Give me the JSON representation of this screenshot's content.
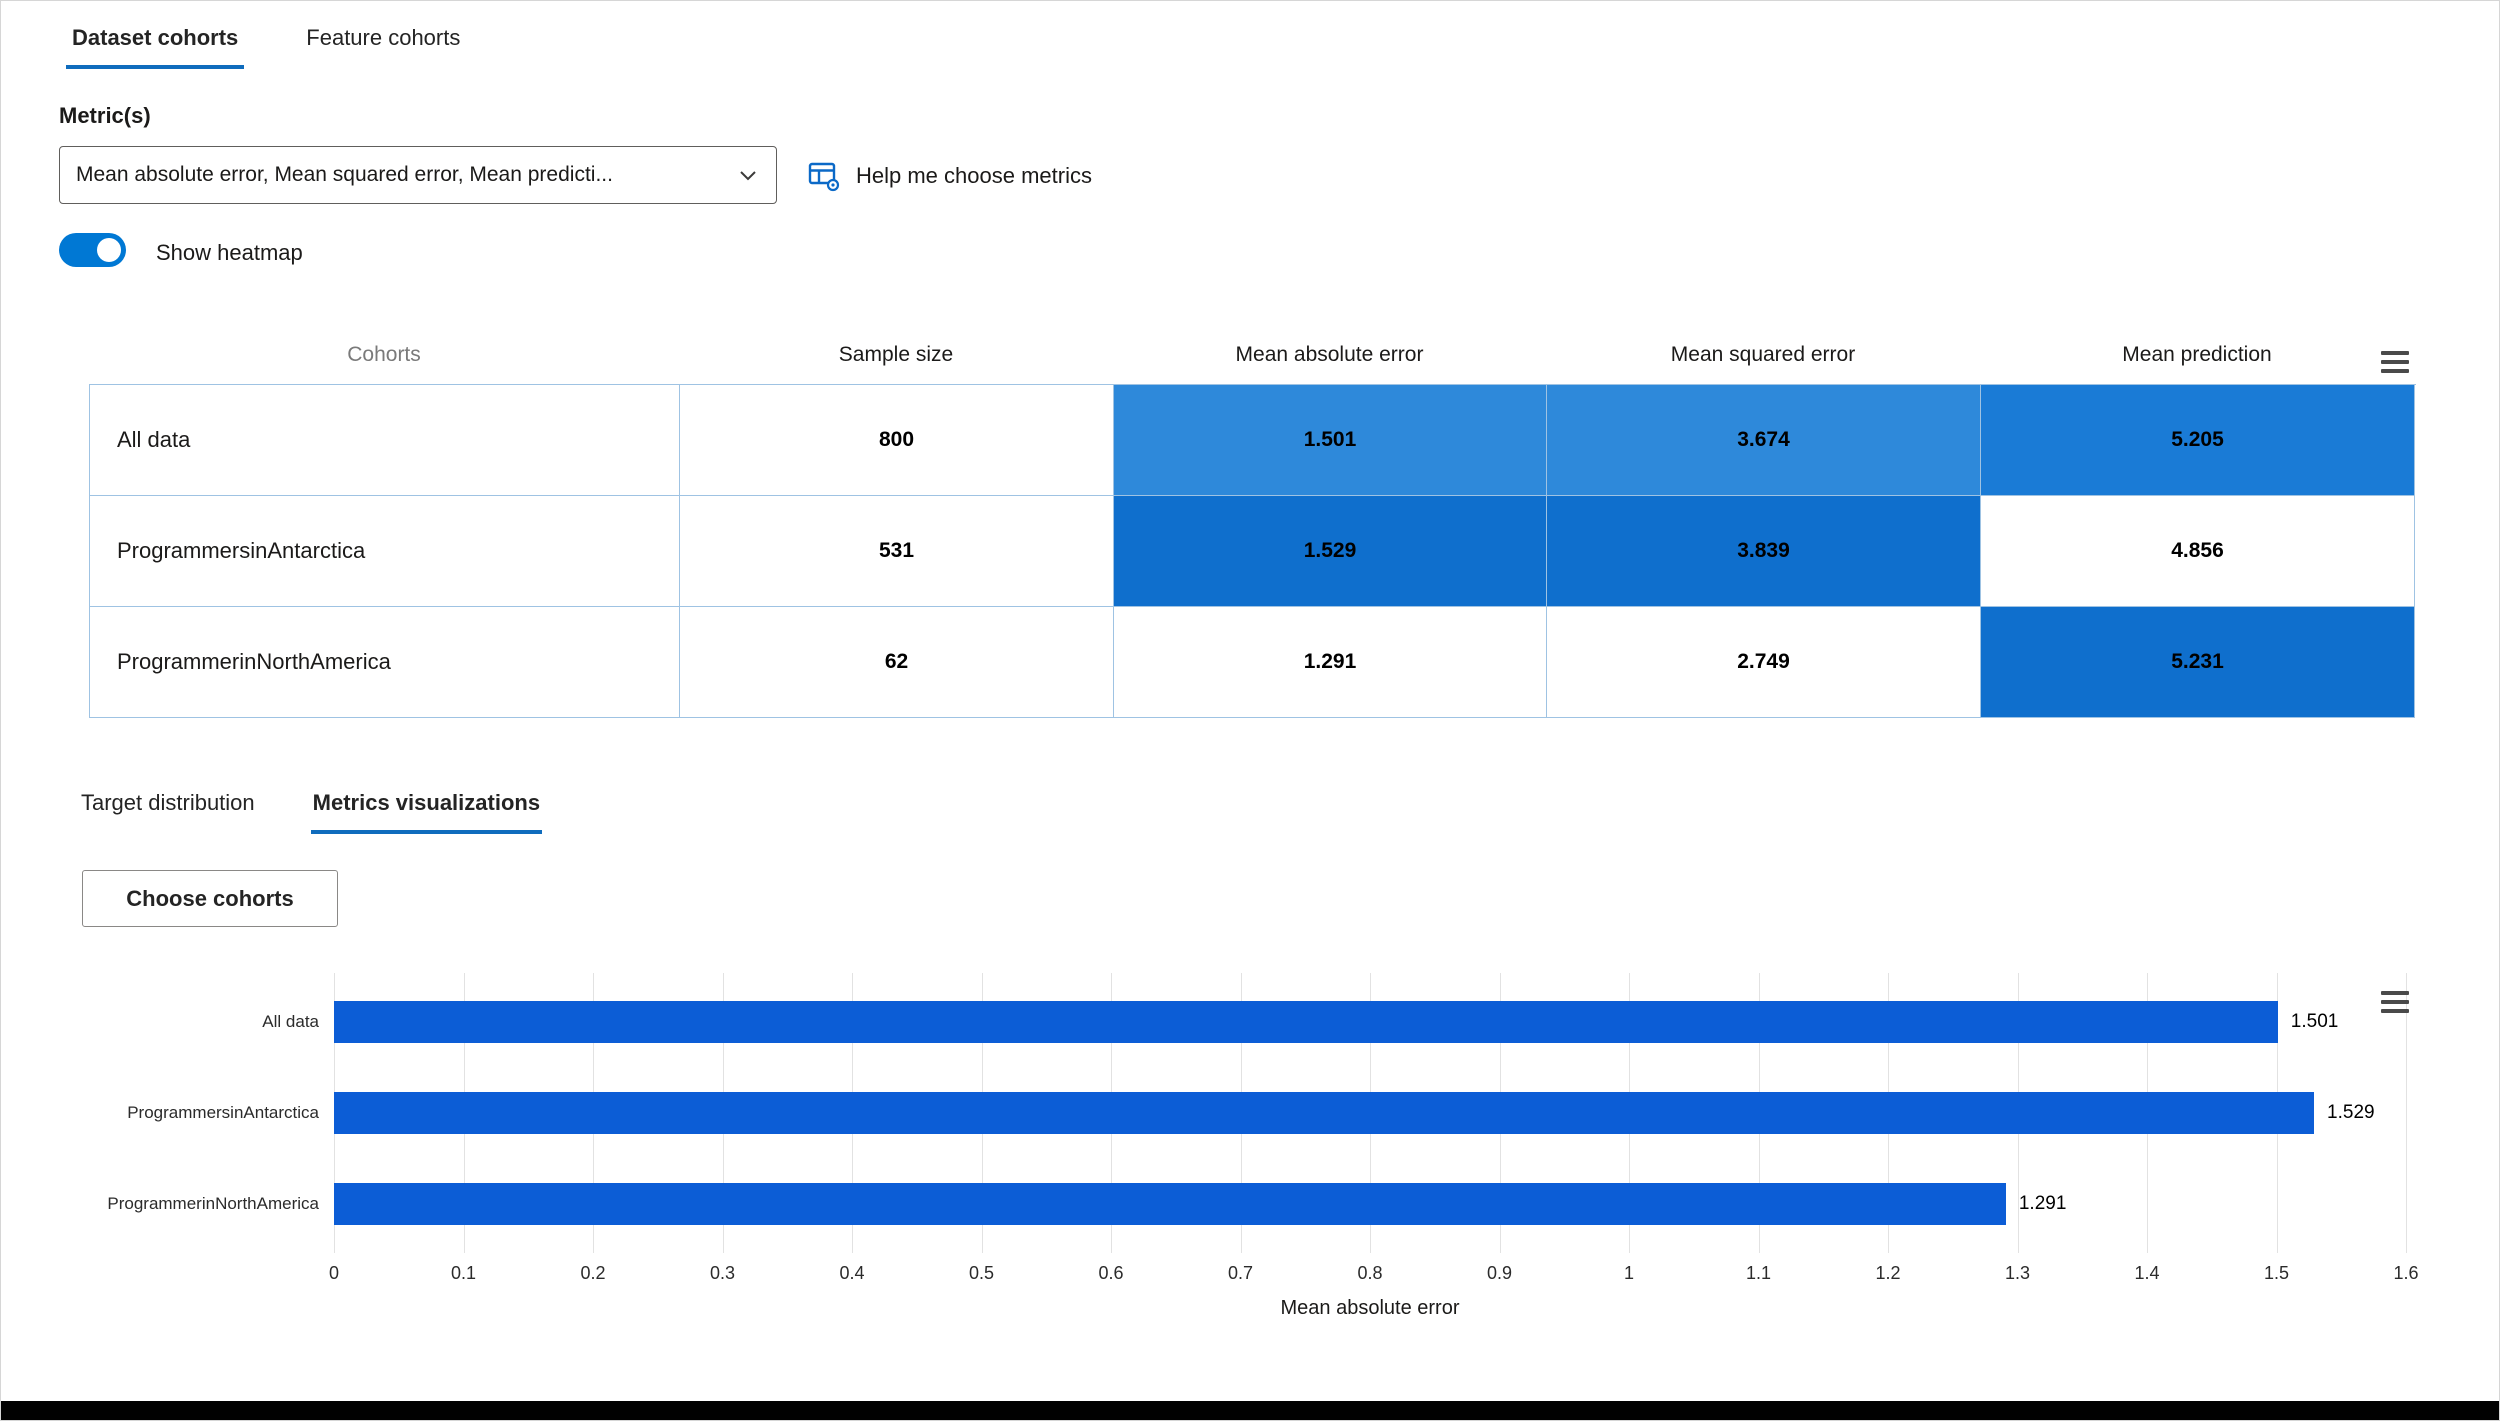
{
  "accent_color": "#0f6cbd",
  "tabs": {
    "dataset_cohorts": "Dataset cohorts",
    "feature_cohorts": "Feature cohorts"
  },
  "metrics_section": {
    "label": "Metric(s)",
    "dropdown_value": "Mean absolute error, Mean squared error, Mean predicti...",
    "help_label": "Help me choose metrics"
  },
  "heatmap_toggle": {
    "label": "Show heatmap",
    "state": "on"
  },
  "table": {
    "headers": [
      "Cohorts",
      "Sample size",
      "Mean absolute error",
      "Mean squared error",
      "Mean prediction"
    ],
    "rows": [
      {
        "cohort": "All data",
        "sample_size": "800",
        "metrics": [
          {
            "value": "1.501",
            "bg": "#2e89da"
          },
          {
            "value": "3.674",
            "bg": "#2e89da"
          },
          {
            "value": "5.205",
            "bg": "#1a7bd6"
          }
        ]
      },
      {
        "cohort": "ProgrammersinAntarctica",
        "sample_size": "531",
        "metrics": [
          {
            "value": "1.529",
            "bg": "#0f6fcd"
          },
          {
            "value": "3.839",
            "bg": "#0f6fcd"
          },
          {
            "value": "4.856",
            "bg": "#ffffff"
          }
        ]
      },
      {
        "cohort": "ProgrammerinNorthAmerica",
        "sample_size": "62",
        "metrics": [
          {
            "value": "1.291",
            "bg": "#ffffff"
          },
          {
            "value": "2.749",
            "bg": "#ffffff"
          },
          {
            "value": "5.231",
            "bg": "#0f6fcd"
          }
        ]
      }
    ]
  },
  "sub_tabs": {
    "target_distribution": "Target distribution",
    "metrics_visualizations": "Metrics visualizations"
  },
  "choose_cohorts_label": "Choose cohorts",
  "chart_data": {
    "type": "bar",
    "orientation": "horizontal",
    "title": "",
    "categories": [
      "All data",
      "ProgrammersinAntarctica",
      "ProgrammerinNorthAmerica"
    ],
    "values": [
      1.501,
      1.529,
      1.291
    ],
    "value_labels": [
      "1.501",
      "1.529",
      "1.291"
    ],
    "xlabel": "Mean absolute error",
    "ylabel": "",
    "xlim": [
      0,
      1.6
    ],
    "xticks": [
      "0",
      "0.1",
      "0.2",
      "0.3",
      "0.4",
      "0.5",
      "0.6",
      "0.7",
      "0.8",
      "0.9",
      "1",
      "1.1",
      "1.2",
      "1.3",
      "1.4",
      "1.5",
      "1.6"
    ],
    "bar_color": "#0c5dd6",
    "grid": true,
    "legend": "none"
  }
}
